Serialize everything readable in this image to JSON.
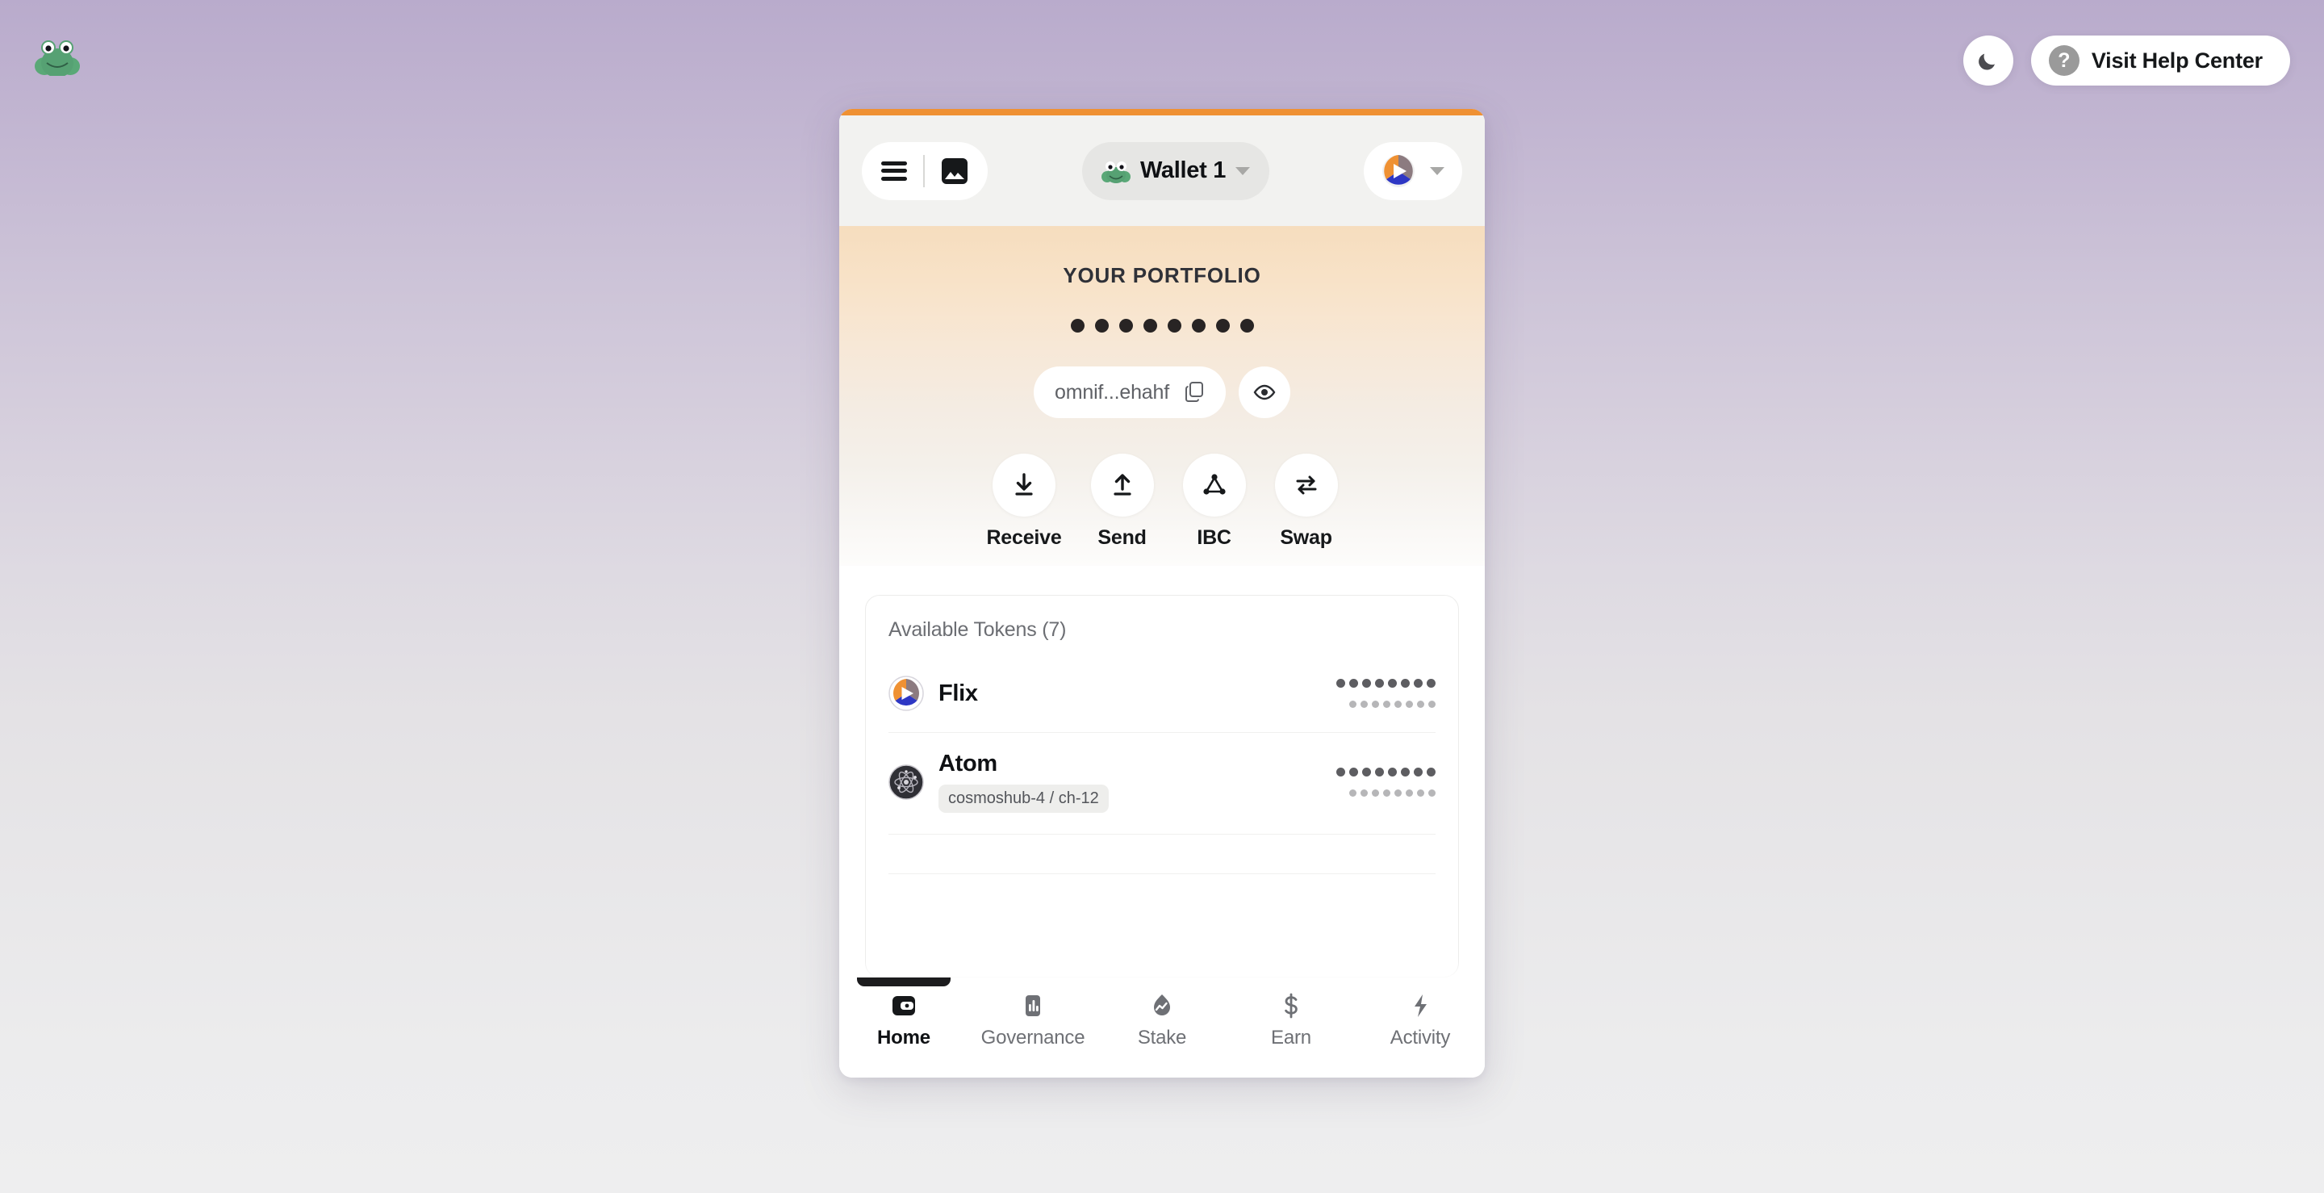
{
  "page": {
    "brand_logo_icon": "frog-logo",
    "theme_toggle_icon": "moon-icon",
    "help_icon": "question-mark-icon",
    "help_label": "Visit Help Center",
    "accent_color": "#ef9133",
    "background_gradient_top": "#b9abcc",
    "background_gradient_bottom": "#eeeeef"
  },
  "wallet_header": {
    "menu_icon": "hamburger-menu-icon",
    "nft_icon": "image-gallery-icon",
    "wallet_avatar_icon": "frog-avatar-icon",
    "wallet_name": "Wallet 1",
    "wallet_chevron_icon": "chevron-down-icon",
    "chain_logo_icon": "flix-logo-icon",
    "chain_chevron_icon": "chevron-down-icon"
  },
  "portfolio": {
    "title": "YOUR PORTFOLIO",
    "balance_masked": true,
    "balance_dot_count": 8,
    "address": "omnif...ehahf",
    "copy_icon": "copy-icon",
    "visibility_icon": "eye-icon"
  },
  "actions": [
    {
      "label": "Receive",
      "icon": "download-arrow-icon"
    },
    {
      "label": "Send",
      "icon": "upload-arrow-icon"
    },
    {
      "label": "IBC",
      "icon": "ibc-nodes-icon"
    },
    {
      "label": "Swap",
      "icon": "swap-arrows-icon"
    }
  ],
  "tokens": {
    "card_title": "Available Tokens (7)",
    "count": 7,
    "items": [
      {
        "name": "Flix",
        "icon": "flix-logo-icon",
        "chain_badge": null,
        "balance_masked": true,
        "balance_dot_count": 8,
        "fiat_dot_count": 8
      },
      {
        "name": "Atom",
        "icon": "atom-logo-icon",
        "chain_badge": "cosmoshub-4 / ch-12",
        "balance_masked": true,
        "balance_dot_count": 8,
        "fiat_dot_count": 8
      }
    ]
  },
  "bottom_nav": {
    "active": "Home",
    "items": [
      {
        "label": "Home",
        "icon": "wallet-icon"
      },
      {
        "label": "Governance",
        "icon": "bar-chart-icon"
      },
      {
        "label": "Stake",
        "icon": "stake-chart-icon"
      },
      {
        "label": "Earn",
        "icon": "dollar-sign-icon"
      },
      {
        "label": "Activity",
        "icon": "lightning-bolt-icon"
      }
    ]
  }
}
